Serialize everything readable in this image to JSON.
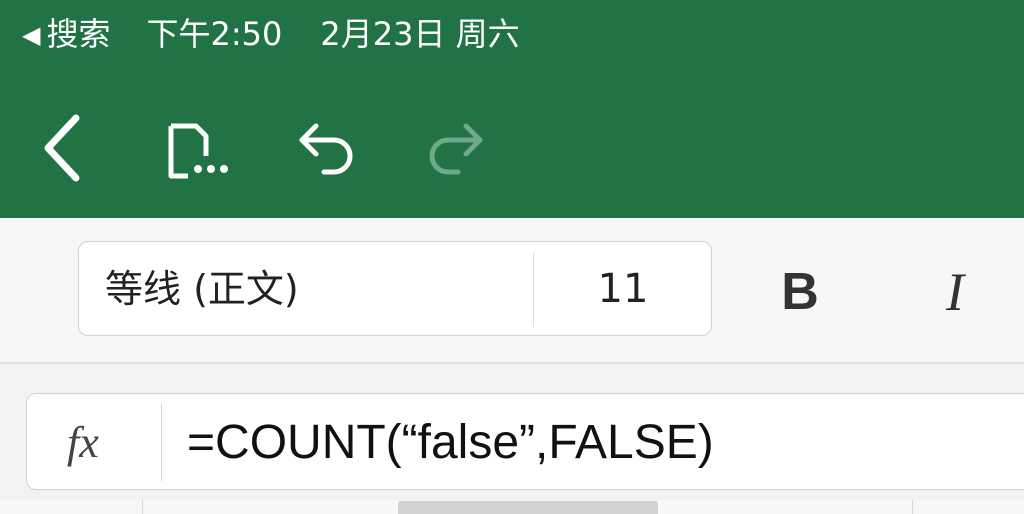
{
  "status_bar": {
    "back_arrow": "◀",
    "back_label": "搜索",
    "time": "下午2:50",
    "date": "2月23日 周六"
  },
  "toolbar": {
    "back_icon": "chevron-left-icon",
    "file_icon": "document-more-icon",
    "undo_icon": "undo-icon",
    "redo_icon": "redo-icon"
  },
  "ribbon": {
    "font_name": "等线 (正文)",
    "font_size": "11",
    "bold_label": "B",
    "italic_label": "I"
  },
  "formula_bar": {
    "fx_label": "fx",
    "formula": "=COUNT(“false”,FALSE)"
  },
  "colors": {
    "header_green": "#217346",
    "ribbon_bg": "#f7f7f7",
    "redo_disabled": "#6fa88a"
  }
}
